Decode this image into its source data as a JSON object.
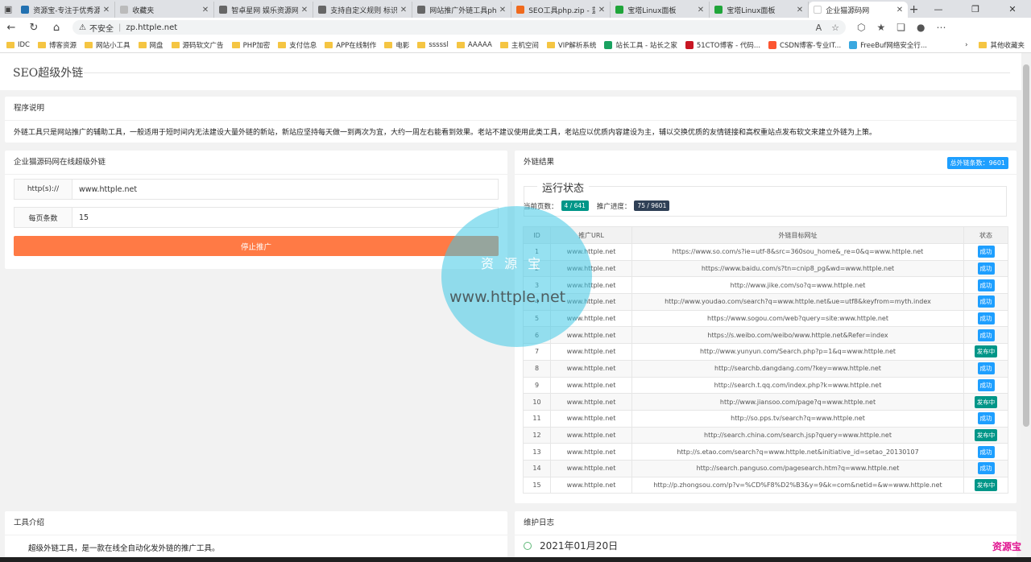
{
  "browser": {
    "tabs": [
      {
        "title": "资源宝-专注于优秀源码",
        "color": "#2271b1"
      },
      {
        "title": "收藏夹",
        "color": "#bbbbbb"
      },
      {
        "title": "智卓星网 娱乐资源网",
        "color": "#666666"
      },
      {
        "title": "支持自定义规则 标识图",
        "color": "#666666"
      },
      {
        "title": "网站推广外链工具php",
        "color": "#666666"
      },
      {
        "title": "SEO工具php.zip - 蓝奏",
        "color": "#f06a1d"
      },
      {
        "title": "宝塔Linux面板",
        "color": "#20a53a"
      },
      {
        "title": "宝塔Linux面板",
        "color": "#20a53a"
      },
      {
        "title": "企业猫源码网",
        "color": "#ffffff",
        "active": true
      }
    ],
    "address": {
      "security": "不安全",
      "url": "zp.httple.net"
    },
    "bookmarks": [
      {
        "label": "IDC",
        "type": "folder"
      },
      {
        "label": "博客资源",
        "type": "folder"
      },
      {
        "label": "网站小工具",
        "type": "folder"
      },
      {
        "label": "网盘",
        "type": "folder"
      },
      {
        "label": "源码软文广告",
        "type": "folder"
      },
      {
        "label": "PHP加密",
        "type": "folder"
      },
      {
        "label": "支付信息",
        "type": "folder"
      },
      {
        "label": "APP在线制作",
        "type": "folder"
      },
      {
        "label": "电影",
        "type": "folder"
      },
      {
        "label": "sssssl",
        "type": "folder"
      },
      {
        "label": "AAAAA",
        "type": "folder"
      },
      {
        "label": "主机空间",
        "type": "folder"
      },
      {
        "label": "VIP解析系统",
        "type": "folder"
      },
      {
        "label": "站长工具 - 站长之家",
        "type": "site",
        "color": "#1aa260"
      },
      {
        "label": "51CTO博客 - 代码...",
        "type": "site",
        "color": "#c81623"
      },
      {
        "label": "CSDN博客-专业IT...",
        "type": "site",
        "color": "#fc5531"
      },
      {
        "label": "FreeBuf网络安全行...",
        "type": "site",
        "color": "#3aa8e0"
      }
    ],
    "other_bookmarks": "其他收藏夹"
  },
  "page": {
    "title": "SEO超级外链",
    "intro": {
      "heading": "程序说明",
      "text": "外链工具只是网站推广的辅助工具，一般适用于短时间内无法建设大量外链的新站，新站应坚持每天做一到两次为宜，大约一周左右能看到效果。老站不建议使用此类工具，老站应以优质内容建设为主，辅以交换优质的友情链接和高权重站点发布软文来建立外链为上策。"
    },
    "form": {
      "heading": "企业猫源码网在线超级外链",
      "url_label": "http(s)://",
      "url_value": "www.httple.net",
      "per_page_label": "每页条数",
      "per_page_value": "15",
      "stop_button": "停止推广"
    },
    "results": {
      "heading": "外链结果",
      "total_badge": "总外链条数：9601",
      "legend": "运行状态",
      "current_page_label": "当前页数：",
      "current_page_value": "4 / 641",
      "progress_label": "推广进度：",
      "progress_value": "75 / 9601",
      "columns": [
        "ID",
        "推广URL",
        "外链目标网址",
        "状态"
      ],
      "rows": [
        {
          "id": "1",
          "url": "www.httple.net",
          "target": "https://www.so.com/s?ie=utf-8&src=360sou_home&_re=0&q=www.httple.net",
          "status": "成功",
          "kind": "ok"
        },
        {
          "id": "2",
          "url": "www.httple.net",
          "target": "https://www.baidu.com/s?tn=cnip8_pg&wd=www.httple.net",
          "status": "成功",
          "kind": "ok"
        },
        {
          "id": "3",
          "url": "www.httple.net",
          "target": "http://www.jike.com/so?q=www.httple.net",
          "status": "成功",
          "kind": "ok"
        },
        {
          "id": "4",
          "url": "www.httple.net",
          "target": "http://www.youdao.com/search?q=www.httple.net&ue=utf8&keyfrom=myth.index",
          "status": "成功",
          "kind": "ok"
        },
        {
          "id": "5",
          "url": "www.httple.net",
          "target": "https://www.sogou.com/web?query=site:www.httple.net",
          "status": "成功",
          "kind": "ok"
        },
        {
          "id": "6",
          "url": "www.httple.net",
          "target": "https://s.weibo.com/weibo/www.httple.net&Refer=index",
          "status": "成功",
          "kind": "ok"
        },
        {
          "id": "7",
          "url": "www.httple.net",
          "target": "http://www.yunyun.com/Search.php?p=1&q=www.httple.net",
          "status": "发布中",
          "kind": "pub"
        },
        {
          "id": "8",
          "url": "www.httple.net",
          "target": "http://searchb.dangdang.com/?key=www.httple.net",
          "status": "成功",
          "kind": "ok"
        },
        {
          "id": "9",
          "url": "www.httple.net",
          "target": "http://search.t.qq.com/index.php?k=www.httple.net",
          "status": "成功",
          "kind": "ok"
        },
        {
          "id": "10",
          "url": "www.httple.net",
          "target": "http://www.jiansoo.com/page?q=www.httple.net",
          "status": "发布中",
          "kind": "pub"
        },
        {
          "id": "11",
          "url": "www.httple.net",
          "target": "http://so.pps.tv/search?q=www.httple.net",
          "status": "成功",
          "kind": "ok"
        },
        {
          "id": "12",
          "url": "www.httple.net",
          "target": "http://search.china.com/search.jsp?query=www.httple.net",
          "status": "发布中",
          "kind": "pub"
        },
        {
          "id": "13",
          "url": "www.httple.net",
          "target": "http://s.etao.com/search?q=www.httple.net&initiative_id=setao_20130107",
          "status": "成功",
          "kind": "ok"
        },
        {
          "id": "14",
          "url": "www.httple.net",
          "target": "http://search.panguso.com/pagesearch.htm?q=www.httple.net",
          "status": "成功",
          "kind": "ok"
        },
        {
          "id": "15",
          "url": "www.httple.net",
          "target": "http://p.zhongsou.com/p?v=%CD%F8%D2%B3&y=9&k=com&netid=&w=www.httple.net",
          "status": "发布中",
          "kind": "pub"
        }
      ]
    },
    "tool_intro": {
      "heading": "工具介绍",
      "text": "超级外链工具，是一款在线全自动化发外链的推广工具。"
    },
    "changelog": {
      "heading": "维护日志",
      "first_date": "2021年01月20日"
    },
    "watermark": {
      "line1": "资 源 宝",
      "line2": "www.httple.net",
      "corner": "资源宝"
    }
  }
}
